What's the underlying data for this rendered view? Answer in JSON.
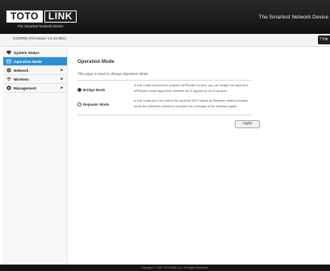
{
  "header": {
    "logo_left": "TOTO",
    "logo_right": "LINK",
    "logo_tagline": "The Smartest Network Device",
    "slogan": "The Smartest Network Device"
  },
  "subbar": {
    "model": "N300RB-(Firmware V3.4s.851)",
    "help_label": "He"
  },
  "sidebar": {
    "items": [
      {
        "label": "System Status",
        "icon": "monitor-icon",
        "active": false,
        "has_arrow": false
      },
      {
        "label": "Operation Mode",
        "icon": "gear-icon",
        "active": true,
        "has_arrow": false
      },
      {
        "label": "Network",
        "icon": "globe-icon",
        "active": false,
        "has_arrow": true
      },
      {
        "label": "Wireless",
        "icon": "wifi-icon",
        "active": false,
        "has_arrow": true
      },
      {
        "label": "Management",
        "icon": "settings-icon",
        "active": false,
        "has_arrow": true
      }
    ],
    "arrow_glyph": "▸"
  },
  "main": {
    "title": "Operation Mode",
    "description": "This page is used to change Operation Mode",
    "modes": [
      {
        "label": "Bridge Mode",
        "checked": true,
        "description": "In this mode,connect the superior AP/Router by wire, you can bridge the superior's AP/Router wired signal into wireless Wi-Fi signals for Wi-Fi devices."
      },
      {
        "label": "Repeater Mode",
        "checked": false,
        "description": "In this mode,you can extend the superior Wi-Fi signal by Repeater setting function under the Wireless column to increase the coverage of the wireless signal."
      }
    ],
    "apply_label": "Apply"
  },
  "footer": {
    "text": "Copyright © 2014 TOTOLINK Ltd.,  All Rights Reserved"
  },
  "colors": {
    "accent": "#2b8fd6",
    "header_bg": "#111111",
    "footer_bg": "#141414"
  }
}
